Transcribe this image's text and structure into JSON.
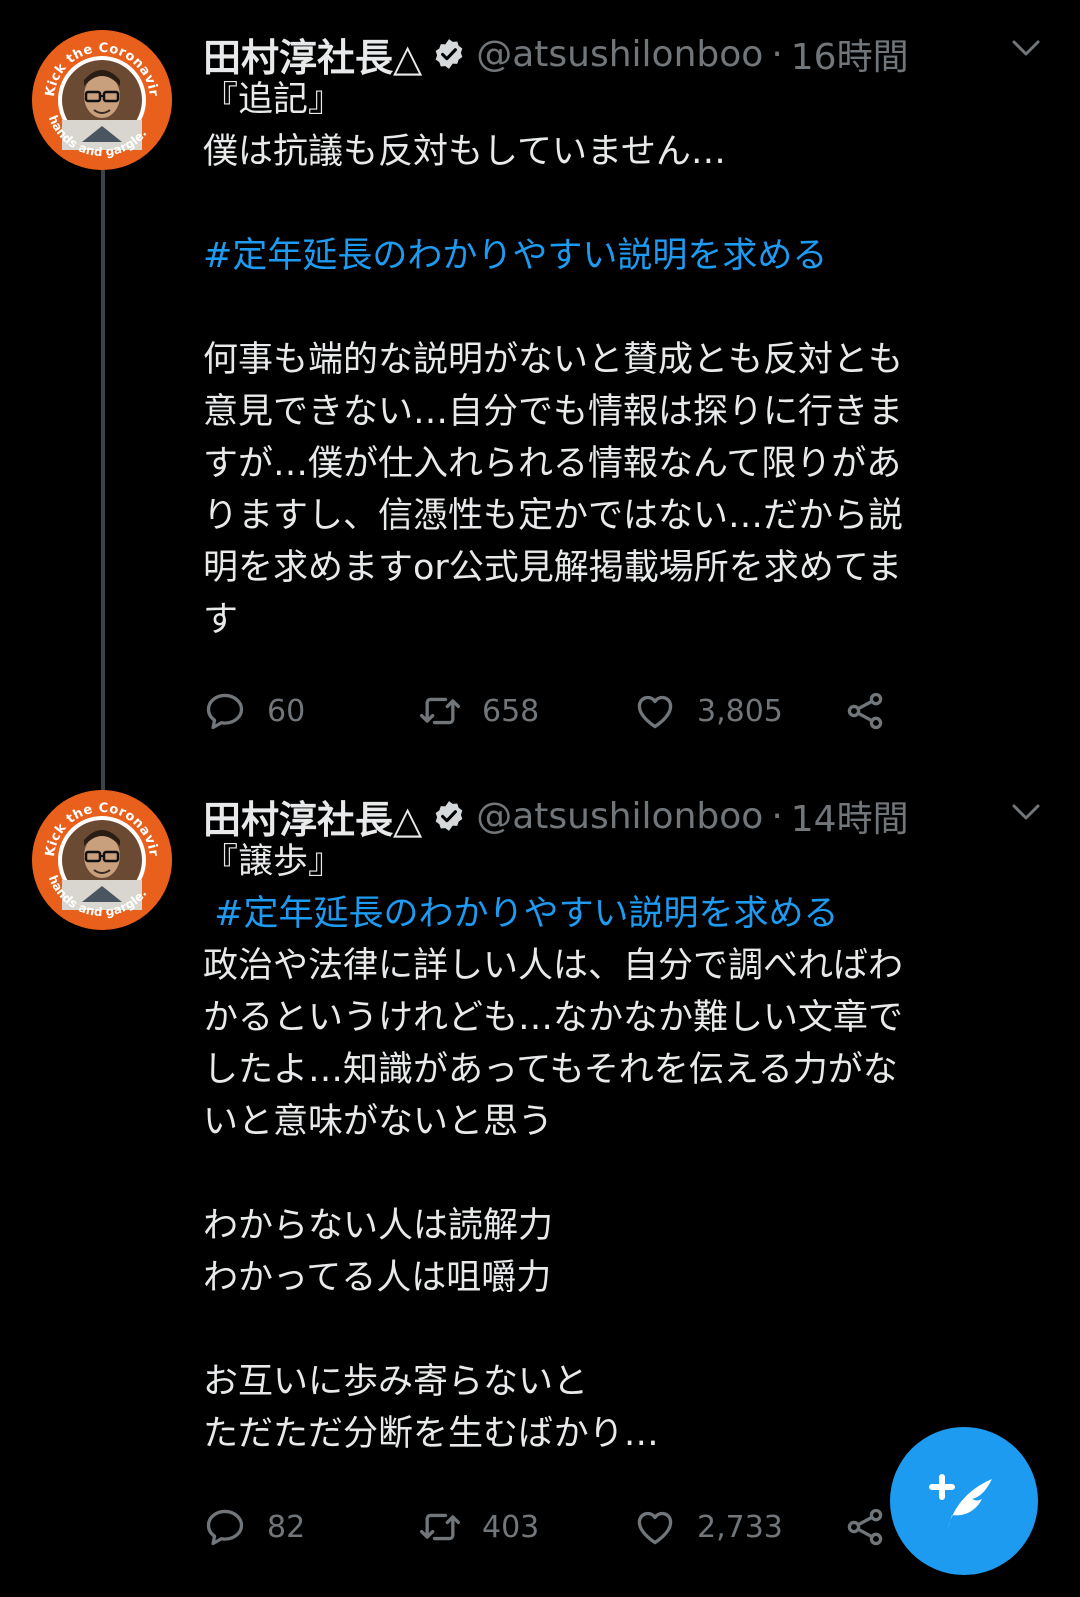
{
  "colors": {
    "background": "#000000",
    "text": "#e7e9ea",
    "muted": "#71767b",
    "accent": "#1d9bf0",
    "avatar_ring": "#e8601c"
  },
  "avatar_ring_text_top": "Kick the Coronavirus.",
  "avatar_ring_text_right": "Wash",
  "avatar_ring_text_bottom": "hands and gargle.",
  "tweets": [
    {
      "name": "田村淳社長△",
      "handle": "@atsushilonboo",
      "separator": "·",
      "time": "16時間",
      "lines": [
        "『追記』",
        "僕は抗議も反対もしていません…",
        "",
        "#定年延長のわかりやすい説明を求める",
        "",
        "何事も端的な説明がないと賛成とも反対とも",
        "意見できない…自分でも情報は探りに行きま",
        "すが…僕が仕入れられる情報なんて限りがあ",
        "りますし、信憑性も定かではない…だから説",
        "明を求めますor公式見解掲載場所を求めてま",
        "す"
      ],
      "reply_count": "60",
      "retweet_count": "658",
      "like_count": "3,805"
    },
    {
      "name": "田村淳社長△",
      "handle": "@atsushilonboo",
      "separator": "·",
      "time": "14時間",
      "lines": [
        "『譲歩』",
        " #定年延長のわかりやすい説明を求める",
        "政治や法律に詳しい人は、自分で調べればわ",
        "かるというけれども…なかなか難しい文章で",
        "したよ…知識があってもそれを伝える力がな",
        "いと意味がないと思う",
        "",
        "わからない人は読解力",
        "わかってる人は咀嚼力",
        "",
        "お互いに歩み寄らないと",
        "ただただ分断を生むばかり…"
      ],
      "reply_count": "82",
      "retweet_count": "403",
      "like_count": "2,733"
    }
  ],
  "icons": {
    "verified": "verified-badge-icon",
    "caret": "chevron-down-icon",
    "reply": "reply-icon",
    "retweet": "retweet-icon",
    "like": "heart-icon",
    "share": "share-icon",
    "compose": "compose-feather-icon"
  }
}
